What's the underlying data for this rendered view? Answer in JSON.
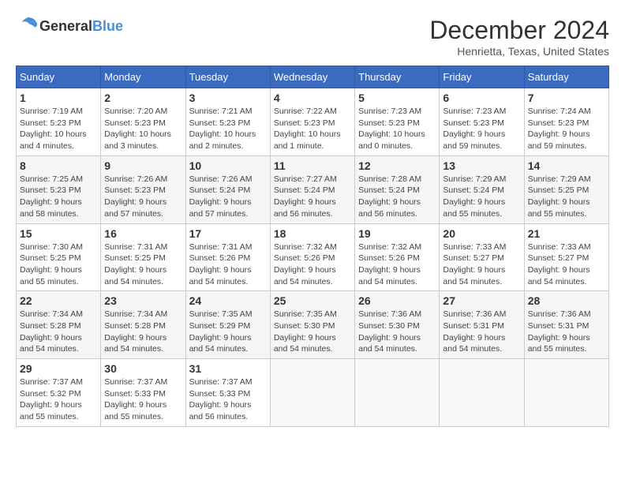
{
  "logo": {
    "line1": "General",
    "line2": "Blue"
  },
  "title": "December 2024",
  "location": "Henrietta, Texas, United States",
  "days_of_week": [
    "Sunday",
    "Monday",
    "Tuesday",
    "Wednesday",
    "Thursday",
    "Friday",
    "Saturday"
  ],
  "weeks": [
    [
      {
        "day": 1,
        "sunrise": "Sunrise: 7:19 AM",
        "sunset": "Sunset: 5:23 PM",
        "daylight": "Daylight: 10 hours and 4 minutes."
      },
      {
        "day": 2,
        "sunrise": "Sunrise: 7:20 AM",
        "sunset": "Sunset: 5:23 PM",
        "daylight": "Daylight: 10 hours and 3 minutes."
      },
      {
        "day": 3,
        "sunrise": "Sunrise: 7:21 AM",
        "sunset": "Sunset: 5:23 PM",
        "daylight": "Daylight: 10 hours and 2 minutes."
      },
      {
        "day": 4,
        "sunrise": "Sunrise: 7:22 AM",
        "sunset": "Sunset: 5:23 PM",
        "daylight": "Daylight: 10 hours and 1 minute."
      },
      {
        "day": 5,
        "sunrise": "Sunrise: 7:23 AM",
        "sunset": "Sunset: 5:23 PM",
        "daylight": "Daylight: 10 hours and 0 minutes."
      },
      {
        "day": 6,
        "sunrise": "Sunrise: 7:23 AM",
        "sunset": "Sunset: 5:23 PM",
        "daylight": "Daylight: 9 hours and 59 minutes."
      },
      {
        "day": 7,
        "sunrise": "Sunrise: 7:24 AM",
        "sunset": "Sunset: 5:23 PM",
        "daylight": "Daylight: 9 hours and 59 minutes."
      }
    ],
    [
      {
        "day": 8,
        "sunrise": "Sunrise: 7:25 AM",
        "sunset": "Sunset: 5:23 PM",
        "daylight": "Daylight: 9 hours and 58 minutes."
      },
      {
        "day": 9,
        "sunrise": "Sunrise: 7:26 AM",
        "sunset": "Sunset: 5:23 PM",
        "daylight": "Daylight: 9 hours and 57 minutes."
      },
      {
        "day": 10,
        "sunrise": "Sunrise: 7:26 AM",
        "sunset": "Sunset: 5:24 PM",
        "daylight": "Daylight: 9 hours and 57 minutes."
      },
      {
        "day": 11,
        "sunrise": "Sunrise: 7:27 AM",
        "sunset": "Sunset: 5:24 PM",
        "daylight": "Daylight: 9 hours and 56 minutes."
      },
      {
        "day": 12,
        "sunrise": "Sunrise: 7:28 AM",
        "sunset": "Sunset: 5:24 PM",
        "daylight": "Daylight: 9 hours and 56 minutes."
      },
      {
        "day": 13,
        "sunrise": "Sunrise: 7:29 AM",
        "sunset": "Sunset: 5:24 PM",
        "daylight": "Daylight: 9 hours and 55 minutes."
      },
      {
        "day": 14,
        "sunrise": "Sunrise: 7:29 AM",
        "sunset": "Sunset: 5:25 PM",
        "daylight": "Daylight: 9 hours and 55 minutes."
      }
    ],
    [
      {
        "day": 15,
        "sunrise": "Sunrise: 7:30 AM",
        "sunset": "Sunset: 5:25 PM",
        "daylight": "Daylight: 9 hours and 55 minutes."
      },
      {
        "day": 16,
        "sunrise": "Sunrise: 7:31 AM",
        "sunset": "Sunset: 5:25 PM",
        "daylight": "Daylight: 9 hours and 54 minutes."
      },
      {
        "day": 17,
        "sunrise": "Sunrise: 7:31 AM",
        "sunset": "Sunset: 5:26 PM",
        "daylight": "Daylight: 9 hours and 54 minutes."
      },
      {
        "day": 18,
        "sunrise": "Sunrise: 7:32 AM",
        "sunset": "Sunset: 5:26 PM",
        "daylight": "Daylight: 9 hours and 54 minutes."
      },
      {
        "day": 19,
        "sunrise": "Sunrise: 7:32 AM",
        "sunset": "Sunset: 5:26 PM",
        "daylight": "Daylight: 9 hours and 54 minutes."
      },
      {
        "day": 20,
        "sunrise": "Sunrise: 7:33 AM",
        "sunset": "Sunset: 5:27 PM",
        "daylight": "Daylight: 9 hours and 54 minutes."
      },
      {
        "day": 21,
        "sunrise": "Sunrise: 7:33 AM",
        "sunset": "Sunset: 5:27 PM",
        "daylight": "Daylight: 9 hours and 54 minutes."
      }
    ],
    [
      {
        "day": 22,
        "sunrise": "Sunrise: 7:34 AM",
        "sunset": "Sunset: 5:28 PM",
        "daylight": "Daylight: 9 hours and 54 minutes."
      },
      {
        "day": 23,
        "sunrise": "Sunrise: 7:34 AM",
        "sunset": "Sunset: 5:28 PM",
        "daylight": "Daylight: 9 hours and 54 minutes."
      },
      {
        "day": 24,
        "sunrise": "Sunrise: 7:35 AM",
        "sunset": "Sunset: 5:29 PM",
        "daylight": "Daylight: 9 hours and 54 minutes."
      },
      {
        "day": 25,
        "sunrise": "Sunrise: 7:35 AM",
        "sunset": "Sunset: 5:30 PM",
        "daylight": "Daylight: 9 hours and 54 minutes."
      },
      {
        "day": 26,
        "sunrise": "Sunrise: 7:36 AM",
        "sunset": "Sunset: 5:30 PM",
        "daylight": "Daylight: 9 hours and 54 minutes."
      },
      {
        "day": 27,
        "sunrise": "Sunrise: 7:36 AM",
        "sunset": "Sunset: 5:31 PM",
        "daylight": "Daylight: 9 hours and 54 minutes."
      },
      {
        "day": 28,
        "sunrise": "Sunrise: 7:36 AM",
        "sunset": "Sunset: 5:31 PM",
        "daylight": "Daylight: 9 hours and 55 minutes."
      }
    ],
    [
      {
        "day": 29,
        "sunrise": "Sunrise: 7:37 AM",
        "sunset": "Sunset: 5:32 PM",
        "daylight": "Daylight: 9 hours and 55 minutes."
      },
      {
        "day": 30,
        "sunrise": "Sunrise: 7:37 AM",
        "sunset": "Sunset: 5:33 PM",
        "daylight": "Daylight: 9 hours and 55 minutes."
      },
      {
        "day": 31,
        "sunrise": "Sunrise: 7:37 AM",
        "sunset": "Sunset: 5:33 PM",
        "daylight": "Daylight: 9 hours and 56 minutes."
      },
      null,
      null,
      null,
      null
    ]
  ]
}
